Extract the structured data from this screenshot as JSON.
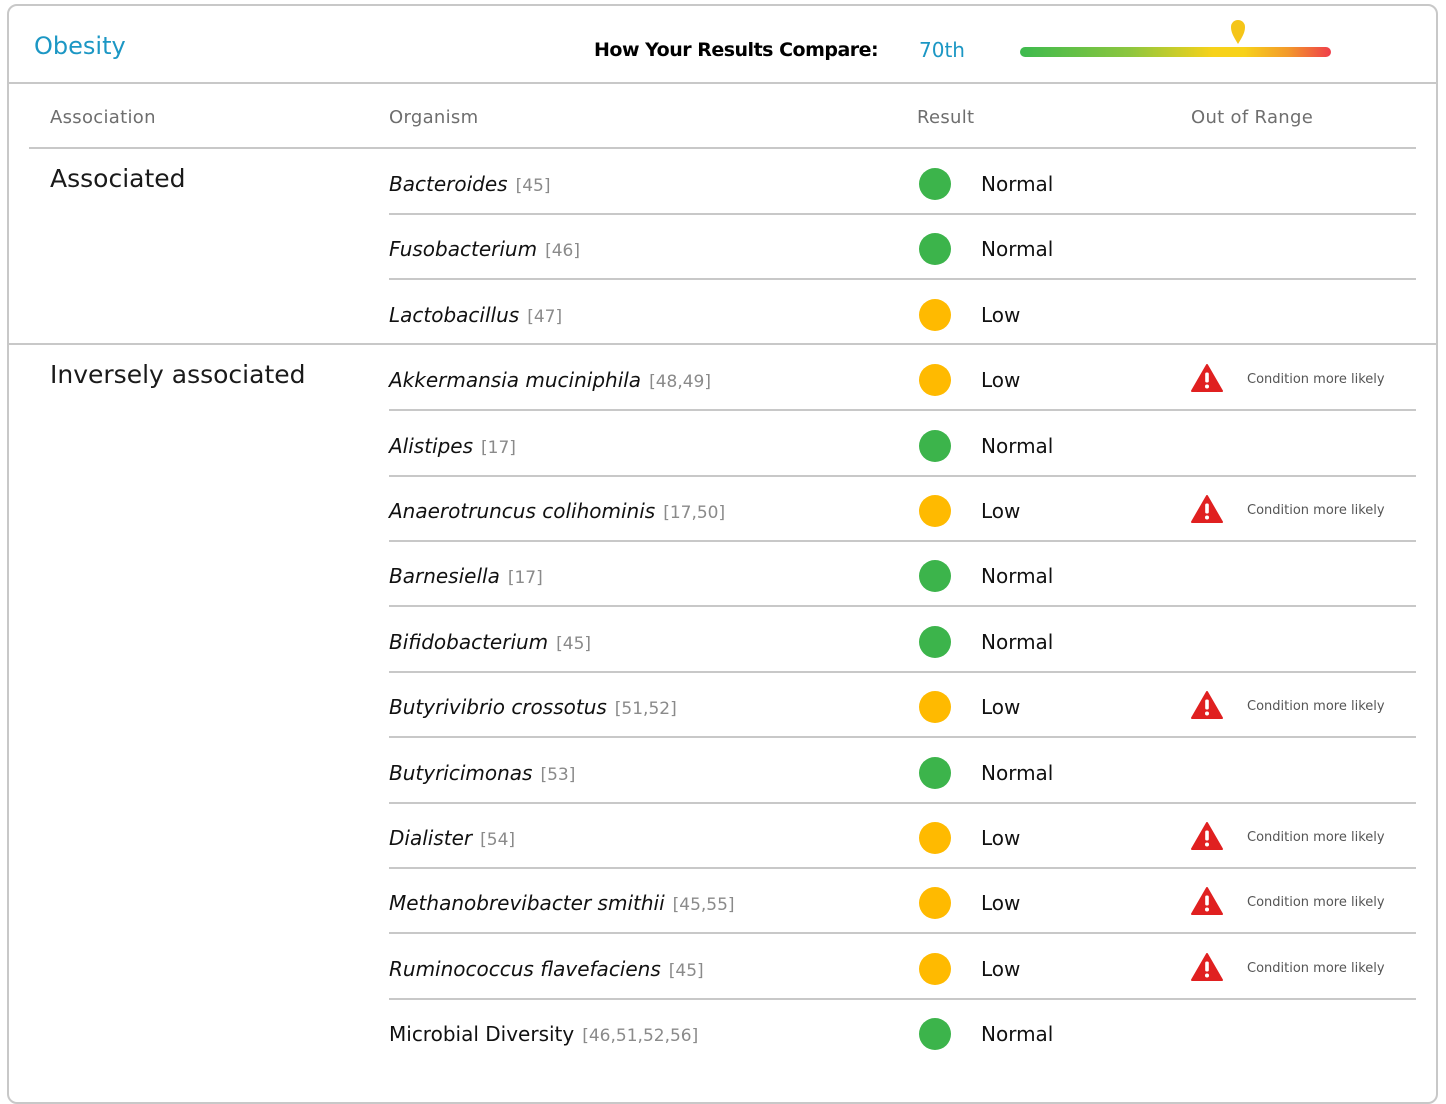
{
  "header": {
    "title": "Obesity",
    "compare_label": "How Your Results Compare:",
    "compare_value": "70th",
    "percentile": 70
  },
  "columns": {
    "association": "Association",
    "organism": "Organism",
    "result": "Result",
    "out_of_range": "Out of Range"
  },
  "colors": {
    "accent": "#1c97c4",
    "normal": "#3cb44b",
    "low": "#ffba00",
    "warning": "#e02020"
  },
  "icons": {
    "status_dot": "status-dot-icon",
    "warning": "warning-triangle-icon",
    "marker": "map-pin-icon"
  },
  "sections": [
    {
      "label": "Associated",
      "rows": [
        {
          "organism": "Bacteroides",
          "italic": true,
          "ref": "[45]",
          "result": "Normal",
          "status": "normal",
          "flag": ""
        },
        {
          "organism": "Fusobacterium",
          "italic": true,
          "ref": "[46]",
          "result": "Normal",
          "status": "normal",
          "flag": ""
        },
        {
          "organism": "Lactobacillus",
          "italic": true,
          "ref": "[47]",
          "result": "Low",
          "status": "low",
          "flag": ""
        }
      ]
    },
    {
      "label": "Inversely associated",
      "rows": [
        {
          "organism": "Akkermansia muciniphila",
          "italic": true,
          "ref": "[48,49]",
          "result": "Low",
          "status": "low",
          "flag": "Condition more likely"
        },
        {
          "organism": "Alistipes",
          "italic": true,
          "ref": "[17]",
          "result": "Normal",
          "status": "normal",
          "flag": ""
        },
        {
          "organism": "Anaerotruncus colihominis",
          "italic": true,
          "ref": "[17,50]",
          "result": "Low",
          "status": "low",
          "flag": "Condition more likely"
        },
        {
          "organism": "Barnesiella",
          "italic": true,
          "ref": "[17]",
          "result": "Normal",
          "status": "normal",
          "flag": ""
        },
        {
          "organism": "Bifidobacterium",
          "italic": true,
          "ref": "[45]",
          "result": "Normal",
          "status": "normal",
          "flag": ""
        },
        {
          "organism": "Butyrivibrio crossotus",
          "italic": true,
          "ref": "[51,52]",
          "result": "Low",
          "status": "low",
          "flag": "Condition more likely"
        },
        {
          "organism": "Butyricimonas",
          "italic": true,
          "ref": "[53]",
          "result": "Normal",
          "status": "normal",
          "flag": ""
        },
        {
          "organism": "Dialister",
          "italic": true,
          "ref": "[54]",
          "result": "Low",
          "status": "low",
          "flag": "Condition more likely"
        },
        {
          "organism": "Methanobrevibacter smithii",
          "italic": true,
          "ref": "[45,55]",
          "result": "Low",
          "status": "low",
          "flag": "Condition more likely"
        },
        {
          "organism": "Ruminococcus flavefaciens",
          "italic": true,
          "ref": "[45]",
          "result": "Low",
          "status": "low",
          "flag": "Condition more likely"
        },
        {
          "organism": "Microbial Diversity",
          "italic": false,
          "ref": "[46,51,52,56]",
          "result": "Normal",
          "status": "normal",
          "flag": ""
        }
      ]
    }
  ]
}
